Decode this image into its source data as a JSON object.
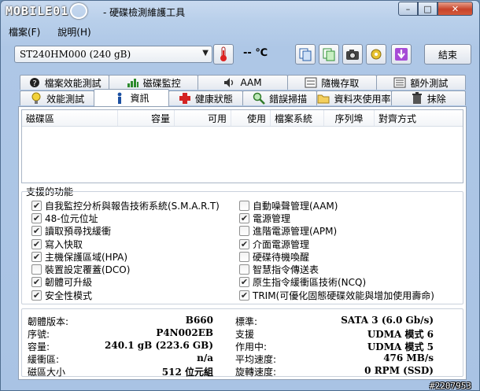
{
  "window": {
    "logo_text": "MOBILE01",
    "title": "- 硬碟檢測維護工具",
    "minimize": "–",
    "maximize": "□",
    "close": "✕"
  },
  "menu": [
    {
      "label": "檔案(F)"
    },
    {
      "label": "說明(H)"
    }
  ],
  "toolbar": {
    "drive": "ST240HM000 (240 gB)",
    "temperature": "-- ℃",
    "exit_label": "結束"
  },
  "tabs_row1": [
    {
      "label": "檔案效能測試",
      "icon": "file-benchmark-icon"
    },
    {
      "label": "磁碟監控",
      "icon": "disk-monitor-icon"
    },
    {
      "label": "AAM",
      "icon": "speaker-icon"
    },
    {
      "label": "隨機存取",
      "icon": "random-access-icon"
    },
    {
      "label": "額外測試",
      "icon": "extra-tests-icon"
    }
  ],
  "tabs_row2": [
    {
      "label": "效能測試",
      "icon": "bulb-icon"
    },
    {
      "label": "資訊",
      "icon": "info-icon"
    },
    {
      "label": "健康狀態",
      "icon": "health-cross-icon"
    },
    {
      "label": "錯誤掃描",
      "icon": "magnifier-icon"
    },
    {
      "label": "資料夾使用率",
      "icon": "folder-icon"
    },
    {
      "label": "抹除",
      "icon": "trash-icon"
    }
  ],
  "partition_table": {
    "headers": [
      "磁碟區",
      "容量",
      "可用",
      "使用",
      "檔案系統",
      "序列埠",
      "對齊方式"
    ],
    "rows": []
  },
  "features": {
    "title": "支援的功能",
    "left": [
      {
        "label": "自我監控分析與報告技術系統(S.M.A.R.T)",
        "checked": true
      },
      {
        "label": "48-位元位址",
        "checked": true
      },
      {
        "label": "讀取預尋找緩衝",
        "checked": true
      },
      {
        "label": "寫入快取",
        "checked": true
      },
      {
        "label": "主機保護區域(HPA)",
        "checked": true
      },
      {
        "label": "裝置設定覆蓋(DCO)",
        "checked": false
      },
      {
        "label": "韌體可升級",
        "checked": true
      },
      {
        "label": "安全性模式",
        "checked": true
      }
    ],
    "right": [
      {
        "label": "自動噪聲管理(AAM)",
        "checked": false
      },
      {
        "label": "電源管理",
        "checked": true
      },
      {
        "label": "進階電源管理(APM)",
        "checked": false
      },
      {
        "label": "介面電源管理",
        "checked": true
      },
      {
        "label": "硬碟待機喚醒",
        "checked": false
      },
      {
        "label": "智慧指令傳送表",
        "checked": false
      },
      {
        "label": "原生指令緩衝區技術(NCQ)",
        "checked": true
      },
      {
        "label": "TRIM(可優化固態硬碟效能與增加使用壽命)",
        "checked": true
      }
    ]
  },
  "info": {
    "left": [
      {
        "label": "韌體版本:",
        "value": "B660"
      },
      {
        "label": "序號:",
        "value": "P4N002EB"
      },
      {
        "label": "容量:",
        "value": "240.1 gB (223.6 GB)"
      },
      {
        "label": "緩衝區:",
        "value": "n/a"
      },
      {
        "label": "磁區大小",
        "value": "512 位元組"
      }
    ],
    "right": [
      {
        "label": "標準:",
        "value": "SATA 3 (6.0 Gb/s)"
      },
      {
        "label": "支援",
        "value": "UDMA 模式 6"
      },
      {
        "label": "作用中:",
        "value": "UDMA 模式 5"
      },
      {
        "label": "平均速度:",
        "value": "476 MB/s"
      },
      {
        "label": "旋轉速度:",
        "value": "0 RPM (SSD)"
      }
    ]
  },
  "watermark": "#2207953"
}
